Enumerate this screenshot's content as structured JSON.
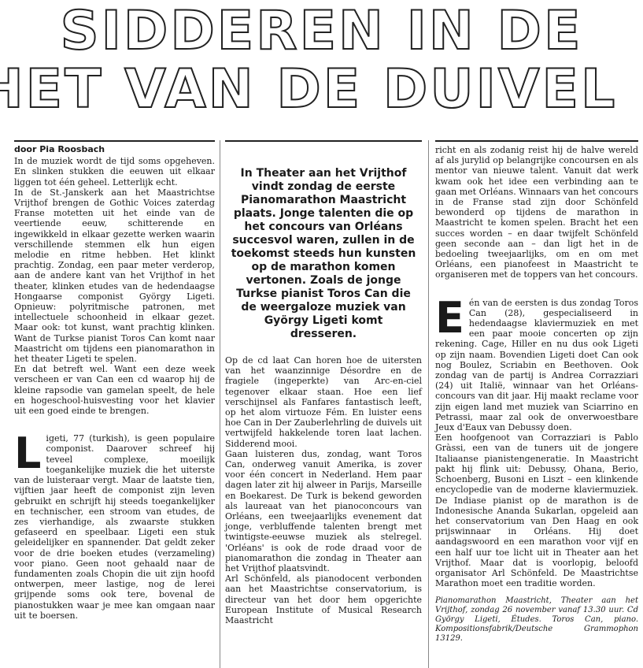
{
  "headline": {
    "line1": "SIDDEREN IN DE",
    "line2": "HET VAN DE DUIVEL"
  },
  "byline": "door Pia Roosbach",
  "col1": {
    "p1": "In de muziek wordt de tijd soms opgeheven. En slinken stukken die eeuwen uit elkaar liggen tot één geheel. Letterlijk echt.",
    "p2": "In de St.-Janskerk aan het Maastrichtse Vrijthof brengen de Gothic Voices zaterdag Franse motetten uit het einde van de veertiende eeuw, schitterende en ingewikkeld in elkaar gezette werken waarin verschillende stemmen elk hun eigen melodie en ritme hebben. Het klinkt prachtig. Zondag, een paar meter verderop, aan de andere kant van het Vrijthof in het theater, klinken etudes van de hedendaagse Hongaarse componist György Ligeti. Opnieuw: polyritmische patronen, met intellectuele schoonheid in elkaar gezet. Maar ook: tot kunst, want prachtig klinken. Want de Turkse pianist Toros Can komt naar Maastricht om tijdens een pianomarathon in het theater Ligeti te spelen.",
    "p3": "En dat betreft wel. Want een deze week verscheen er van Can een cd waarop hij de kleine rapsodie van gamelan speelt, de hele en hogeschool-huisvesting voor het klavier uit een goed einde te brengen.",
    "drop": "L",
    "p4": "igeti, 77 (turkish), is geen populaire componist. Daarover schreef hij teveel complexe, moeilijk toegankelijke muziek die het uiterste van de luisteraar vergt. Maar de laatste tien, vijftien jaar heeft de componist zijn leven gebruikt en schrijft hij steeds toegankelijker en technischer, een stroom van etudes, de zes vierhandige, als zwaarste stukken gefaseerd en speelbaar. Ligeti een stuk geleidelijker en spannender. Dat geldt zeker voor de drie boeken etudes (verzameling) voor piano. Geen noot gehaald naar de fundamenten zoals Chopin die uit zijn hoofd ontwerpen, meer lastige, nog de lerei grijpende soms ook tere, bovenal de pianostukken waar je mee kan omgaan naar uit te boersen."
  },
  "col2": {
    "lead": "In Theater aan het Vrijthof vindt zondag de eerste Pianomarathon Maastricht plaats. Jonge talenten die op het concours van Orléans succesvol waren, zullen in de toekomst steeds hun kunsten op de marathon komen vertonen. Zoals de jonge Turkse pianist Toros Can die de weergaloze muziek van György Ligeti komt dresseren.",
    "p1": "Op de cd laat Can horen hoe de uitersten van het waanzinnige Désordre en de fragiele (ingeperkte) van Arc-en-ciel tegenover elkaar staan. Hoe een lief verschijnsel als Fanfares fantastisch leeft, op het alom virtuoze Fém. En luister eens hoe Can in Der Zauberlehrling de duivels uit vertwijfeld hakkelende toren laat lachen. Sidderend mooi.",
    "p2": "Gaan luisteren dus, zondag, want Toros Can, onderweg vanuit Amerika, is zover voor één concert in Nederland. Hem paar dagen later zit hij alweer in Parijs, Marseille en Boekarest. De Turk is bekend geworden als laureaat van het pianoconcours van Orléans, een tweejaarlijks evenement dat jonge, verbluffende talenten brengt met twintigste-eeuwse muziek als stelregel. 'Orléans' is ook de rode draad voor de pianomarathon die zondag in Theater aan het Vrijthof plaatsvindt.",
    "p3": "Arl Schönfeld, als pianodocent verbonden aan het Maastrichtse conservatorium, is directeur van het door hem opgerichte European Institute of Musical Research Maastricht"
  },
  "col3": {
    "p1": "richt en als zodanig reist hij de halve wereld af als jurylid op belangrijke concoursen en als mentor van nieuwe talent. Vanuit dat werk kwam ook het idee een verbinding aan te gaan met Orléans. Winnaars van het concours in de Franse stad zijn door Schönfeld bewonderd op tijdens de marathon in Maastricht te komen spelen. Bracht het een succes worden – en daar twijfelt Schönfeld geen seconde aan – dan ligt het in de bedoeling tweejaarlijks, om en om met Orléans, een pianofeest in Maastricht te organiseren met de toppers van het concours.",
    "drop": "E",
    "p2": "én van de eersten is dus zondag Toros Can (28), gespecialiseerd in hedendaagse klaviermuziek en met een paar mooie concerten op zijn rekening. Cage, Hiller en nu dus ook Ligeti op zijn naam. Bovendien Ligeti doet Can ook nog Boulez, Scriabin en Beethoven. Ook zondag van de partij is Andrea Corrazziari (24) uit Italië, winnaar van het Orléans-concours van dit jaar. Hij maakt reclame voor zijn eigen land met muziek van Sciarrino en Petrassi, maar zal ook de onverwoestbare Jeux d'Eaux van Debussy doen.",
    "p3": "Een hoofgenoot van Corrazziari is Pablo Gràssi, een van de tuners uit de jongere Italiaanse pianistengeneratie. In Maastricht pakt hij flink uit: Debussy, Ohana, Berio, Schoenberg, Busoni en Liszt – een klinkende encyclopedie van de moderne klaviermuziek. De Indiase pianist op de marathon is de Indonesische Ananda Sukarlan, opgeleid aan het conservatorium van Den Haag en ook prijswinnaar in Orléans. Hij doet aandagswoord en een marathon voor vijf en een half uur toe licht uit in Theater aan het Vrijthof. Maar dat is voorlopig, beloofd organisator Arl Schönfeld. De Maastrichtse Marathon moet een traditie worden.",
    "credit": "Pianomarathon Maastricht, Theater aan het Vrijthof, zondag 26 november vanaf 13.30 uur. Cd György Ligeti, Études. Toros Can, piano. Kompositionsfabrik/Deutsche Grammophon 13129."
  }
}
